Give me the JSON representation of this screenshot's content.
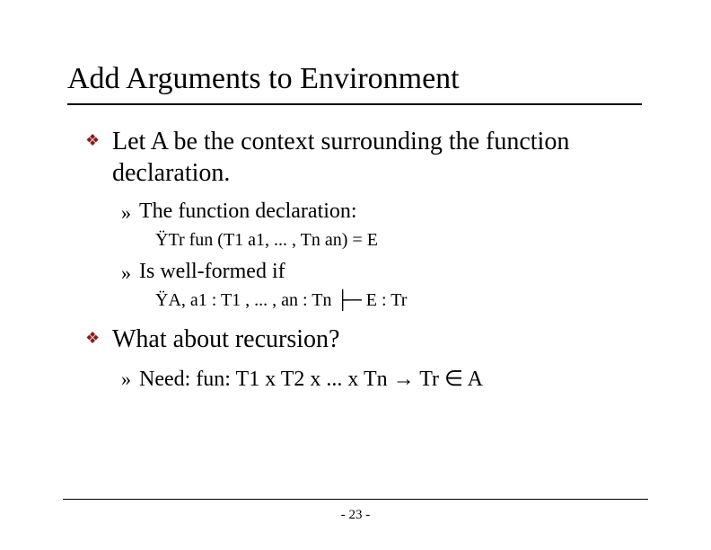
{
  "title": "Add Arguments to Environment",
  "bullets": {
    "b1": "Let A be the context surrounding the function declaration.",
    "b1_1": "The function declaration:",
    "b1_1_1": "ŸTr fun (T1 a1, ... , Tn an) = E",
    "b1_2": "Is well-formed if",
    "b1_2_1": "ŸA, a1 : T1 , ... , an : Tn ├─ E : Tr",
    "b2": "What about recursion?",
    "b2_1": "Need: fun: T1 x T2 x ... x Tn → Tr ∈ A"
  },
  "page": "- 23 -"
}
